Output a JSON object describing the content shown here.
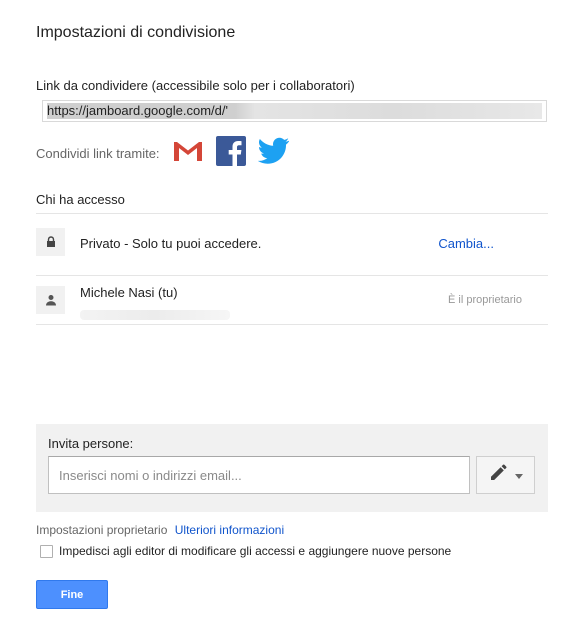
{
  "dialog": {
    "title": "Impostazioni di condivisione"
  },
  "link": {
    "label": "Link da condividere (accessibile solo per i collaboratori)",
    "value": "https://jamboard.google.com/d/'"
  },
  "share": {
    "label": "Condividi link tramite:",
    "icons": [
      "gmail-icon",
      "facebook-icon",
      "twitter-icon"
    ],
    "colors": {
      "gmail": "#d44638",
      "facebook": "#3b5998",
      "twitter": "#1da1f2"
    }
  },
  "access": {
    "heading": "Chi ha accesso",
    "rows": [
      {
        "icon": "lock-icon",
        "text": "Privato - Solo tu puoi accedere.",
        "action": "Cambia..."
      },
      {
        "icon": "person-icon",
        "text": "Michele Nasi (tu)",
        "role": "È il proprietario"
      }
    ]
  },
  "invite": {
    "label": "Invita persone:",
    "placeholder": "Inserisci nomi o indirizzi email...",
    "permission_icon": "pencil-icon"
  },
  "owner_settings": {
    "label": "Impostazioni proprietario",
    "link": "Ulteriori informazioni",
    "checkbox_label": "Impedisci agli editor di modificare gli accessi e aggiungere nuove persone",
    "checked": false
  },
  "buttons": {
    "done": "Fine"
  },
  "theme": {
    "accent": "#4d90fe",
    "link": "#1155cc"
  }
}
